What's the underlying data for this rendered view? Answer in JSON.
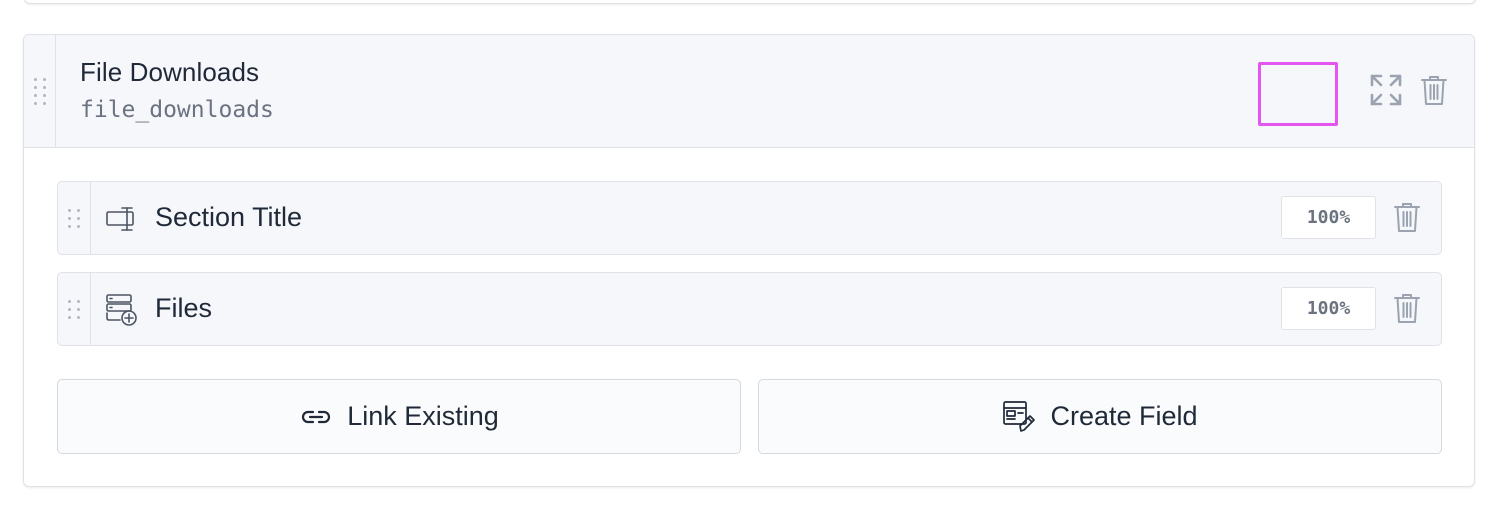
{
  "block": {
    "title": "File Downloads",
    "handle": "file_downloads",
    "actions": {
      "expand_icon": "expand-icon",
      "delete_icon": "trash-icon"
    }
  },
  "fields": [
    {
      "label": "Section Title",
      "icon": "section-title-icon",
      "width": "100%"
    },
    {
      "label": "Files",
      "icon": "files-icon",
      "width": "100%"
    }
  ],
  "buttons": {
    "link_existing": "Link Existing",
    "create_field": "Create Field"
  },
  "colors": {
    "highlight": "#e357f0",
    "panel": "#f6f7fb",
    "border": "#dfe3e8",
    "icon": "#9aa3af"
  }
}
